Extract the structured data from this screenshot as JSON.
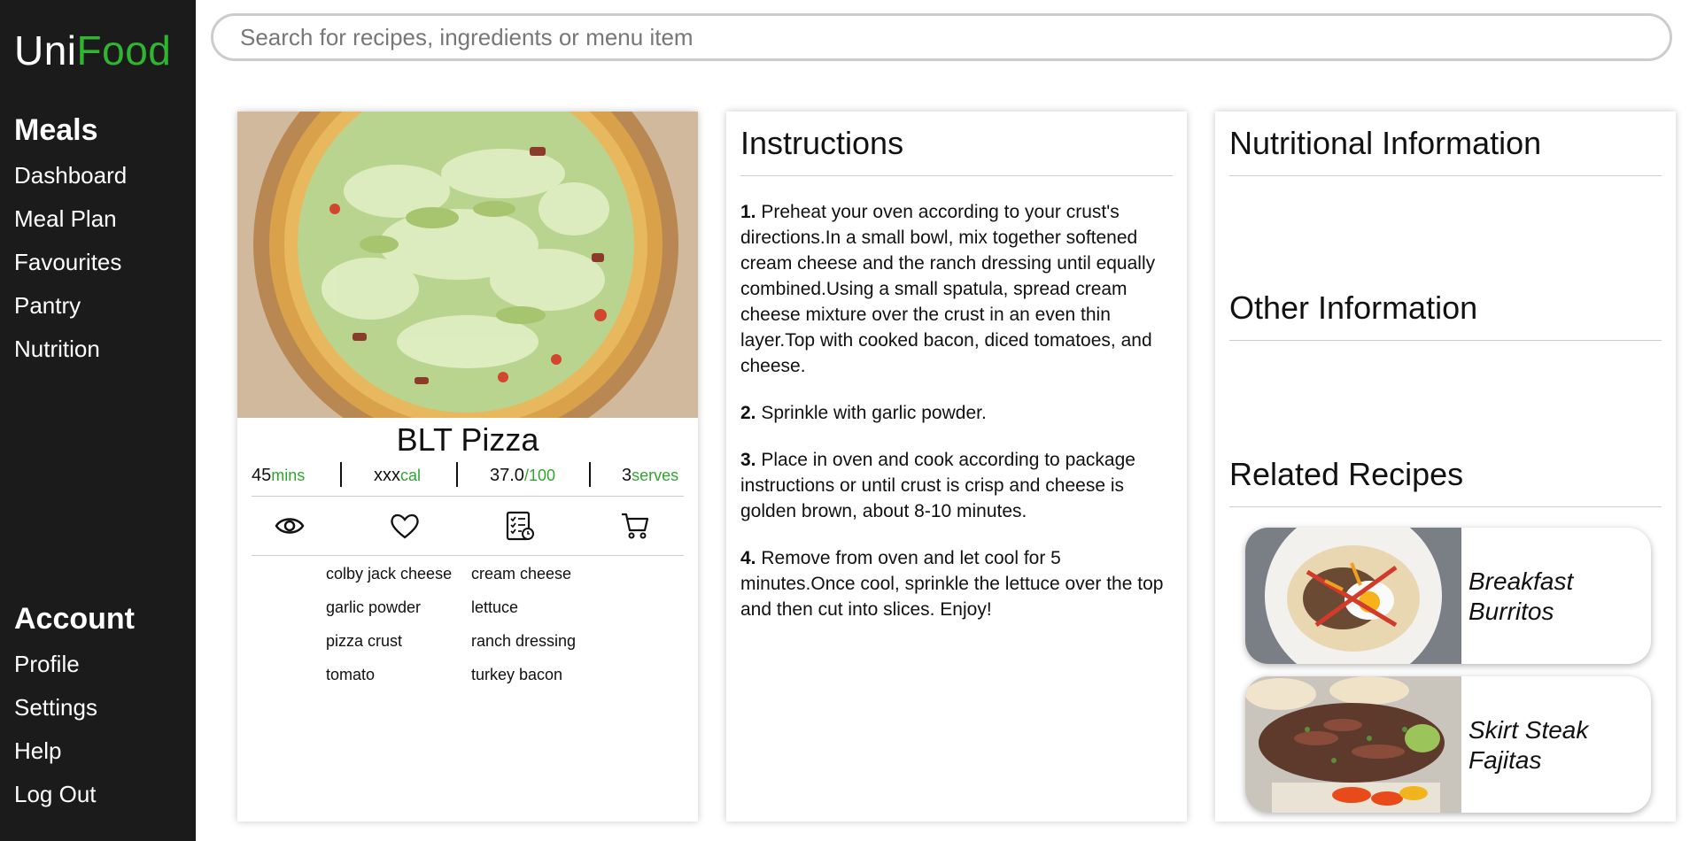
{
  "app": {
    "logo_uni": "Uni",
    "logo_food": "Food"
  },
  "search": {
    "placeholder": "Search for recipes, ingredients or menu item"
  },
  "sidebar": {
    "meals_heading": "Meals",
    "meals_items": [
      "Dashboard",
      "Meal Plan",
      "Favourites",
      "Pantry",
      "Nutrition"
    ],
    "account_heading": "Account",
    "account_items": [
      "Profile",
      "Settings",
      "Help",
      "Log Out"
    ]
  },
  "recipe": {
    "title": "BLT Pizza",
    "time_value": "45",
    "time_unit": "mins",
    "cal_value": "xxx",
    "cal_unit": "cal",
    "score_value": "37.0",
    "score_unit": "/100",
    "serves_value": "3",
    "serves_unit": "serves",
    "actions": [
      "eye-icon",
      "heart-icon",
      "checklist-icon",
      "cart-icon"
    ],
    "ingredients": [
      "colby jack cheese",
      "cream cheese",
      "garlic powder",
      "lettuce",
      "pizza crust",
      "ranch dressing",
      "tomato",
      "turkey bacon"
    ]
  },
  "instructions": {
    "title": "Instructions",
    "steps": [
      {
        "num": "1.",
        "text": " Preheat your oven according to your crust's directions.In a small bowl, mix together softened cream cheese and the ranch dressing until equally combined.Using a small spatula, spread cream cheese mixture over the crust in an even thin layer.Top with cooked bacon, diced tomatoes, and cheese."
      },
      {
        "num": "2.",
        "text": " Sprinkle with garlic powder."
      },
      {
        "num": "3.",
        "text": " Place in oven and cook according to package instructions or until crust is crisp and cheese is golden brown, about 8-10 minutes."
      },
      {
        "num": "4.",
        "text": " Remove from oven and let cool for 5 minutes.Once cool, sprinkle the lettuce over the top and then cut into slices. Enjoy!"
      }
    ]
  },
  "info": {
    "nutrition_title": "Nutritional Information",
    "other_title": "Other Information",
    "related_title": "Related Recipes",
    "related": [
      {
        "title_line1": "Breakfast",
        "title_line2": "Burritos"
      },
      {
        "title_line1": "Skirt Steak",
        "title_line2": "Fajitas"
      }
    ]
  },
  "colors": {
    "brand_green": "#2fb52f",
    "sidebar_bg": "#1b1b1b"
  }
}
